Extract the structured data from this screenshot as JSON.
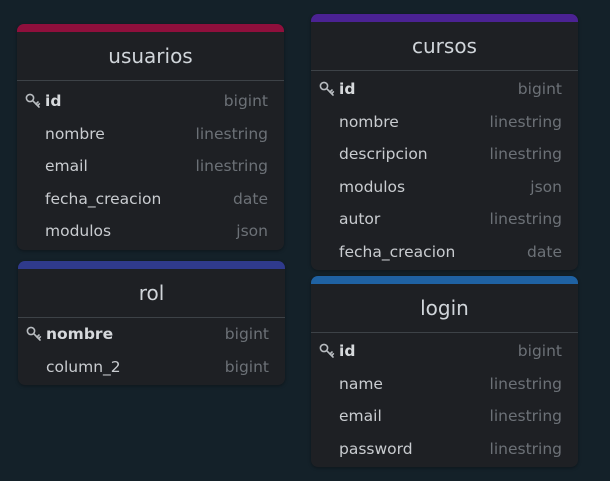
{
  "colors": {
    "usuarios": "#8f0f3c",
    "cursos": "#4b2293",
    "rol": "#2f3a8c",
    "login": "#1f62a3"
  },
  "tables": [
    {
      "id": "usuarios",
      "title": "usuarios",
      "fields": [
        {
          "name": "id",
          "type": "bigint",
          "pk": true
        },
        {
          "name": "nombre",
          "type": "linestring",
          "pk": false
        },
        {
          "name": "email",
          "type": "linestring",
          "pk": false
        },
        {
          "name": "fecha_creacion",
          "type": "date",
          "pk": false
        },
        {
          "name": "modulos",
          "type": "json",
          "pk": false
        }
      ]
    },
    {
      "id": "cursos",
      "title": "cursos",
      "fields": [
        {
          "name": "id",
          "type": "bigint",
          "pk": true
        },
        {
          "name": "nombre",
          "type": "linestring",
          "pk": false
        },
        {
          "name": "descripcion",
          "type": "linestring",
          "pk": false
        },
        {
          "name": "modulos",
          "type": "json",
          "pk": false
        },
        {
          "name": "autor",
          "type": "linestring",
          "pk": false
        },
        {
          "name": "fecha_creacion",
          "type": "date",
          "pk": false
        }
      ]
    },
    {
      "id": "rol",
      "title": "rol",
      "fields": [
        {
          "name": "nombre",
          "type": "bigint",
          "pk": true
        },
        {
          "name": "column_2",
          "type": "bigint",
          "pk": false
        }
      ]
    },
    {
      "id": "login",
      "title": "login",
      "fields": [
        {
          "name": "id",
          "type": "bigint",
          "pk": true
        },
        {
          "name": "name",
          "type": "linestring",
          "pk": false
        },
        {
          "name": "email",
          "type": "linestring",
          "pk": false
        },
        {
          "name": "password",
          "type": "linestring",
          "pk": false
        }
      ]
    }
  ]
}
